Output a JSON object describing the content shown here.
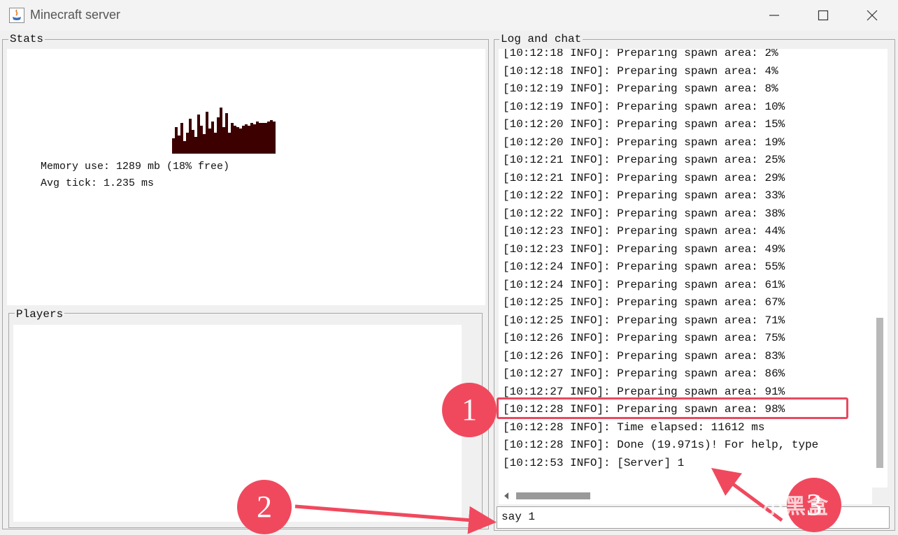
{
  "window": {
    "title": "Minecraft server"
  },
  "stats": {
    "title": "Stats",
    "memory_line": "Memory use: 1289 mb (18% free)",
    "tick_line": "Avg tick: 1.235 ms"
  },
  "players": {
    "title": "Players"
  },
  "log": {
    "title": "Log and chat",
    "lines": [
      "[10:12:18 INFO]: Preparing spawn area: 2%",
      "[10:12:18 INFO]: Preparing spawn area: 4%",
      "[10:12:19 INFO]: Preparing spawn area: 8%",
      "[10:12:19 INFO]: Preparing spawn area: 10%",
      "[10:12:20 INFO]: Preparing spawn area: 15%",
      "[10:12:20 INFO]: Preparing spawn area: 19%",
      "[10:12:21 INFO]: Preparing spawn area: 25%",
      "[10:12:21 INFO]: Preparing spawn area: 29%",
      "[10:12:22 INFO]: Preparing spawn area: 33%",
      "[10:12:22 INFO]: Preparing spawn area: 38%",
      "[10:12:23 INFO]: Preparing spawn area: 44%",
      "[10:12:23 INFO]: Preparing spawn area: 49%",
      "[10:12:24 INFO]: Preparing spawn area: 55%",
      "[10:12:24 INFO]: Preparing spawn area: 61%",
      "[10:12:25 INFO]: Preparing spawn area: 67%",
      "[10:12:25 INFO]: Preparing spawn area: 71%",
      "[10:12:26 INFO]: Preparing spawn area: 75%",
      "[10:12:26 INFO]: Preparing spawn area: 83%",
      "[10:12:27 INFO]: Preparing spawn area: 86%",
      "[10:12:27 INFO]: Preparing spawn area: 91%",
      "[10:12:28 INFO]: Preparing spawn area: 98%",
      "[10:12:28 INFO]: Time elapsed: 11612 ms",
      "[10:12:28 INFO]: Done (19.971s)! For help, type",
      "[10:12:53 INFO]: [Server] 1"
    ]
  },
  "command_input": {
    "value": "say 1"
  },
  "annotations": {
    "marker_1": "1",
    "marker_2": "2",
    "marker_3": "3"
  },
  "watermark": "小黑盒",
  "colors": {
    "annotation": "#e8495f",
    "graph": "#3d0000"
  }
}
